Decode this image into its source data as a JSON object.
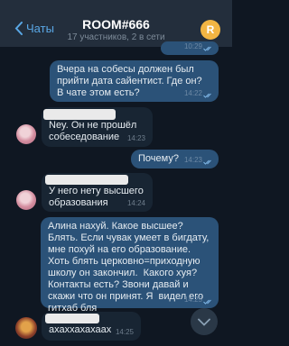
{
  "header": {
    "back_label": "Чаты",
    "title": "ROOM#666",
    "subtitle": "17 участников, 2 в сети",
    "avatar_letter": "R"
  },
  "messages": [
    {
      "dir": "out",
      "text": "",
      "time": "10:29"
    },
    {
      "dir": "out",
      "text": "Вчера на собесы должен был прийти дата сайентист. Где он? В чате этом есть?",
      "time": "14:22"
    },
    {
      "dir": "in",
      "text": "Ney. Он не прошёл собеседование",
      "time": "14:23"
    },
    {
      "dir": "out",
      "text": "Почему?",
      "time": "14:23"
    },
    {
      "dir": "in",
      "text": "У него нету высшего образования",
      "time": "14:24"
    },
    {
      "dir": "out",
      "text": "Алина нахуй. Какое высшее? Блять. Если чувак умеет в бигдату, мне похуй на его образование. Хоть блять церковно=приходную школу он закончил.  Какого хуя? Контакты есть? Звони давай и скажи что он принят. Я  видел его гитхаб бля",
      "time": "14:25"
    },
    {
      "dir": "in",
      "text": "ахаххахахаах",
      "time": "14:25"
    }
  ],
  "colors": {
    "background": "#0f1722",
    "header": "#232e3c",
    "outgoing_bubble": "#2b5278",
    "incoming_bubble": "#182533",
    "accent": "#5aa8e6"
  }
}
